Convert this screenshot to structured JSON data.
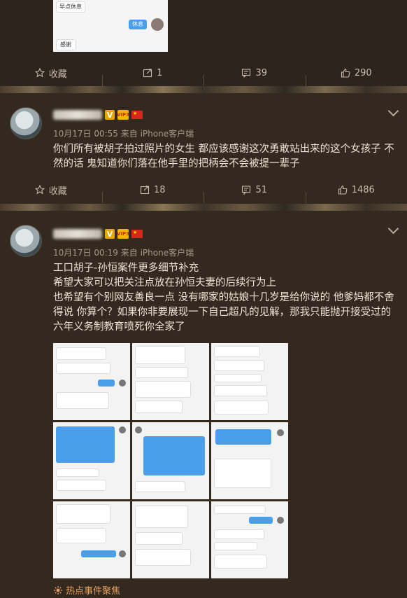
{
  "top_image": {
    "msg1": "早点休息",
    "msg2": "休息",
    "msg3": "感谢"
  },
  "post1_actions": {
    "favorite": "收藏",
    "repost": "1",
    "comment": "39",
    "like": "290"
  },
  "comment1": {
    "meta": "10月17日 00:55 来自 iPhone客户端",
    "text": "你们所有被胡子拍过照片的女生 都应该感谢这次勇敢站出来的这个女孩子 不然的话 鬼知道你们落在他手里的把柄会不会被提一辈子",
    "favorite": "收藏",
    "repost": "18",
    "comment": "51",
    "like": "1486"
  },
  "comment2": {
    "meta": "10月17日 00:19 来自 iPhone客户端",
    "line1": "工口胡子-孙恒案件更多细节补充",
    "line2": "希望大家可以把关注点放在孙恒夫妻的后续行为上",
    "line3": "也希望有个别网友善良一点  没有哪家的姑娘十几岁是给你说的 他爹妈都不舍得说 你算个？如果你非要展现一下自己超凡的见解，那我只能抛开接受过的六年义务制教育喷死你全家了",
    "topic": "热点事件聚焦"
  },
  "badges": {
    "v": "V",
    "vip": "VIP3"
  },
  "colors": {
    "bg": "#2c241d",
    "card": "#33291f",
    "accent": "#e8a05c",
    "bubble_blue": "#4a9eea"
  },
  "icons": [
    "star-icon",
    "repost-icon",
    "comment-icon",
    "thumbs-up-icon",
    "chevron-down-icon",
    "fire-icon"
  ]
}
